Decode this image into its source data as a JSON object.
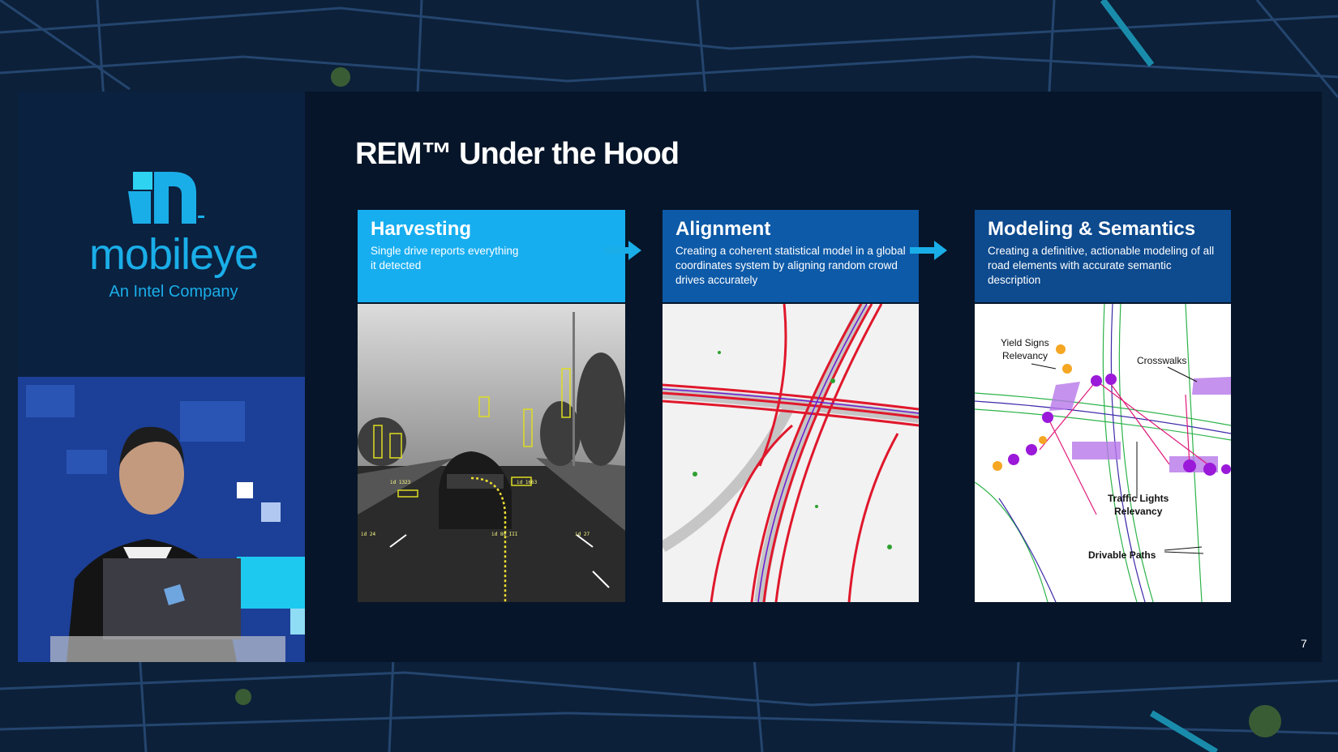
{
  "slide": {
    "title": "REM™ Under the Hood",
    "page_number": "7"
  },
  "brand": {
    "name": "mobileye",
    "tagline": "An Intel Company",
    "logo_icon": "mobileye-m-logo-icon",
    "accent_color": "#1aaee8"
  },
  "panels": [
    {
      "title": "Harvesting",
      "description_lines": [
        "Single drive reports everything",
        "it detected"
      ],
      "header_color": "#17aef0",
      "image_labels": [
        "id 24",
        "id 80_III",
        "id 27",
        "id 1323",
        "id 1663"
      ]
    },
    {
      "title": "Alignment",
      "description_lines": [
        "Creating a coherent statistical model in a global",
        "coordinates system by aligning random crowd",
        "drives accurately"
      ],
      "header_color": "#0d5aa8"
    },
    {
      "title": "Modeling & Semantics",
      "description_lines": [
        "Creating a definitive, actionable modeling of all",
        "road elements with  accurate semantic",
        "description"
      ],
      "header_color": "#0d4a8e",
      "image_labels": {
        "yield_line1": "Yield Signs",
        "yield_line2": "Relevancy",
        "crosswalks": "Crosswalks",
        "traffic_line1": "Traffic Lights",
        "traffic_line2": "Relevancy",
        "drivable": "Drivable Paths"
      }
    }
  ]
}
